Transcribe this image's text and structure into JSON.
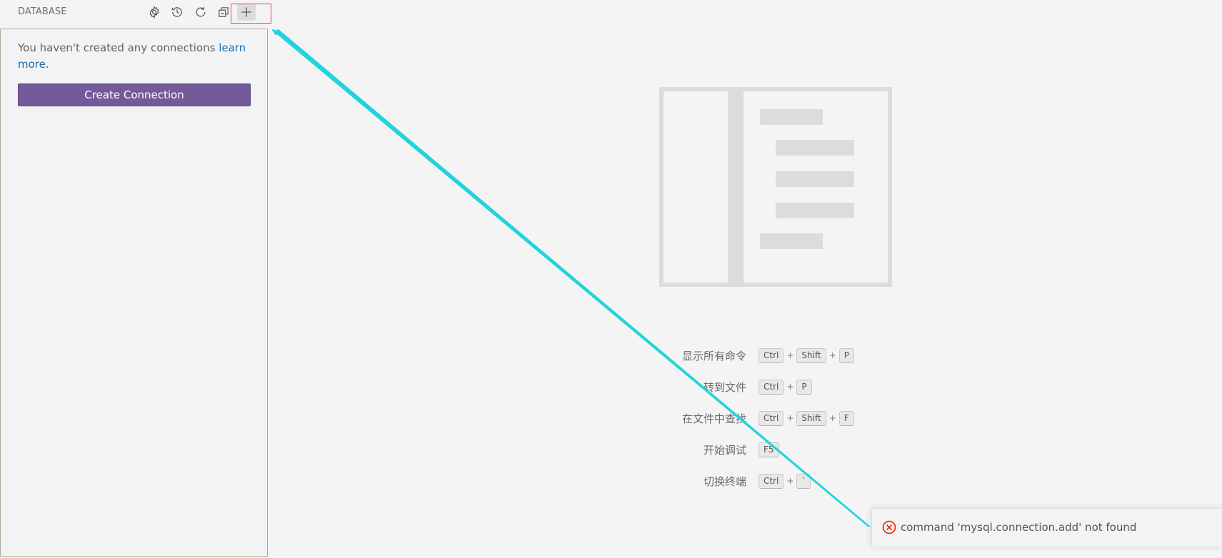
{
  "sidebar": {
    "title": "DATABASE",
    "toolbar": {
      "settings_icon": "gear-icon",
      "history_icon": "history-icon",
      "refresh_icon": "refresh-icon",
      "collapse_icon": "collapse-all-icon",
      "add_icon": "plus-icon"
    },
    "welcome_text": "You haven't created any connections ",
    "learn_more": "learn more",
    "period": ".",
    "create_connection": "Create Connection"
  },
  "editor": {
    "shortcuts": [
      {
        "label": "显示所有命令",
        "keys": [
          "Ctrl",
          "Shift",
          "P"
        ]
      },
      {
        "label": "转到文件",
        "keys": [
          "Ctrl",
          "P"
        ]
      },
      {
        "label": "在文件中查找",
        "keys": [
          "Ctrl",
          "Shift",
          "F"
        ]
      },
      {
        "label": "开始调试",
        "keys": [
          "F5"
        ]
      },
      {
        "label": "切换终端",
        "keys": [
          "Ctrl",
          "`"
        ]
      }
    ],
    "key_separator": "+"
  },
  "notification": {
    "type": "error",
    "message": "command 'mysql.connection.add' not found"
  },
  "colors": {
    "accent_button": "#735a9a",
    "link": "#1a6fb0",
    "error": "#e51400",
    "annotation_arrow": "#22d3dd",
    "highlight_box": "#ff3b3b"
  }
}
